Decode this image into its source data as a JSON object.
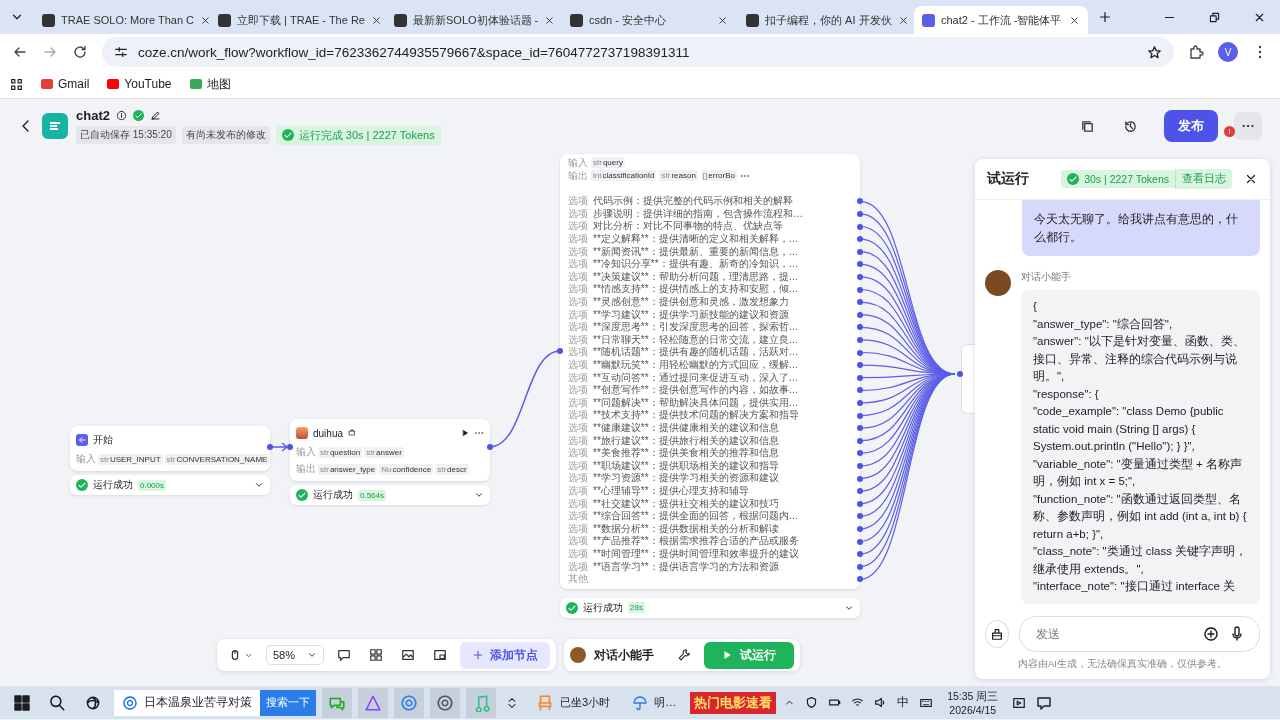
{
  "browser": {
    "tabs": [
      {
        "title": "TRAE SOLO: More Than C",
        "selected": false
      },
      {
        "title": "立即下载 | TRAE - The Re",
        "selected": false
      },
      {
        "title": "最新新SOLO初体验话题 -",
        "selected": false
      },
      {
        "title": "csdn - 安全中心",
        "selected": false
      },
      {
        "title": "扣子编程，你的 AI 开发伙",
        "selected": false
      },
      {
        "title": "chat2 - 工作流 -智能体平",
        "selected": true
      }
    ],
    "url": "coze.cn/work_flow?workflow_id=7623362744935579667&space_id=7604772737198391311",
    "bookmarks": [
      "Gmail",
      "YouTube",
      "地图"
    ],
    "profile": "V"
  },
  "header": {
    "title": "chat2",
    "autosave": "已自动保存 15:35:20",
    "unpublished": "有尚未发布的修改",
    "run_status": "运行完成 30s | 2227 Tokens",
    "publish": "发布",
    "badge": "!"
  },
  "nodes": {
    "start": {
      "title": "开始",
      "input_label": "输入",
      "inputs": [
        {
          "type": "str",
          "name": "USER_INPUT"
        },
        {
          "type": "str",
          "name": "CONVERSATION_NAME"
        }
      ],
      "status": "运行成功",
      "time": "0.000s"
    },
    "llm": {
      "title": "duihua",
      "input_label": "输入",
      "inputs": [
        {
          "type": "str",
          "name": "question"
        },
        {
          "type": "str",
          "name": "answer"
        }
      ],
      "output_label": "输出",
      "outputs": [
        {
          "type": "str",
          "name": "answer_type"
        },
        {
          "type": "Nu",
          "name": "confidence"
        },
        {
          "type": "str",
          "name": "descr"
        }
      ],
      "status": "运行成功",
      "time": "0.564s"
    },
    "classifier": {
      "input_label": "输入",
      "inputs": [
        {
          "type": "str",
          "name": "query"
        }
      ],
      "output_label": "输出",
      "outputs": [
        {
          "type": "int",
          "name": "classificationId"
        },
        {
          "type": "str",
          "name": "reason"
        },
        {
          "type": "[]",
          "name": "errorBo"
        }
      ],
      "options": [
        {
          "label": "选项",
          "text": "代码示例：提供完整的代码示例和相关的解释"
        },
        {
          "label": "选项",
          "text": "步骤说明：提供详细的指南，包含操作流程和…"
        },
        {
          "label": "选项",
          "text": "对比分析：对比不同事物的特点、优缺点等"
        },
        {
          "label": "选项",
          "text": "**定义解释**：提供清晰的定义和相关解释，…"
        },
        {
          "label": "选项",
          "text": "**新闻资讯**：提供最新、重要的新闻信息，…"
        },
        {
          "label": "选项",
          "text": "**冷知识分享**：提供有趣、新奇的冷知识，…"
        },
        {
          "label": "选项",
          "text": "**决策建议**：帮助分析问题，理清思路，提…"
        },
        {
          "label": "选项",
          "text": "**情感支持**：提供情感上的支持和安慰，倾…"
        },
        {
          "label": "选项",
          "text": "**灵感创意**：提供创意和灵感，激发想象力"
        },
        {
          "label": "选项",
          "text": "**学习建议**：提供学习新技能的建议和资源"
        },
        {
          "label": "选项",
          "text": "**深度思考**：引发深度思考的回答，探索哲…"
        },
        {
          "label": "选项",
          "text": "**日常聊天**：轻松随意的日常交流，建立良…"
        },
        {
          "label": "选项",
          "text": "**随机话题**：提供有趣的随机话题，活跃对…"
        },
        {
          "label": "选项",
          "text": "**幽默玩笑**：用轻松幽默的方式回应，缓解…"
        },
        {
          "label": "选项",
          "text": "**互动问答**：通过提问来促进互动，深入了…"
        },
        {
          "label": "选项",
          "text": "**创意写作**：提供创意写作的内容，如故事…"
        },
        {
          "label": "选项",
          "text": "**问题解决**：帮助解决具体问题，提供实用…"
        },
        {
          "label": "选项",
          "text": "**技术支持**：提供技术问题的解决方案和指导"
        },
        {
          "label": "选项",
          "text": "**健康建议**：提供健康相关的建议和信息"
        },
        {
          "label": "选项",
          "text": "**旅行建议**：提供旅行相关的建议和信息"
        },
        {
          "label": "选项",
          "text": "**美食推荐**：提供美食相关的推荐和信息"
        },
        {
          "label": "选项",
          "text": "**职场建议**：提供职场相关的建议和指导"
        },
        {
          "label": "选项",
          "text": "**学习资源**：提供学习相关的资源和建议"
        },
        {
          "label": "选项",
          "text": "**心理辅导**：提供心理支持和辅导"
        },
        {
          "label": "选项",
          "text": "**社交建议**：提供社交相关的建议和技巧"
        },
        {
          "label": "选项",
          "text": "**综合回答**：提供全面的回答，根据问题内…"
        },
        {
          "label": "选项",
          "text": "**数据分析**：提供数据相关的分析和解读"
        },
        {
          "label": "选项",
          "text": "**产品推荐**：根据需求推荐合适的产品或服务"
        },
        {
          "label": "选项",
          "text": "**时间管理**：提供时间管理和效率提升的建议"
        },
        {
          "label": "选项",
          "text": "**语言学习**：提供语言学习的方法和资源"
        }
      ],
      "other": "其他",
      "status": "运行成功",
      "time": "28s"
    }
  },
  "toolbar": {
    "zoom": "58%",
    "add_node": "添加节点",
    "bot": "对话小能手",
    "run": "试运行"
  },
  "panel": {
    "title": "试运行",
    "status": "30s | 2227 Tokens",
    "log_link": "查看日志",
    "user_message": "今天太无聊了。给我讲点有意思的，什么都行。",
    "bot_name": "对话小能手",
    "bot_reply": "{\n\"answer_type\": \"综合回答\",\n\"answer\": \"以下是针对变量、函数、类、接口、异常、注释的综合代码示例与说明。\",\n\"response\": {\n\"code_example\": \"class Demo {public static void main (String [] args) { System.out.println (\"Hello\"); } }\",\n\"variable_note\": \"变量通过类型 + 名称声明，例如 int x = 5;\",\n\"function_note\": \"函数通过返回类型、名称、参数声明，例如 int add (int a, int b) { return a+b; }\",\n\"class_note\": \"类通过 class 关键字声明，继承使用 extends。\",\n\"interface_note\": \"接口通过 interface 关",
    "placeholder": "发送",
    "disclaimer": "内容由AI生成，无法确保真实准确，仅供参考。"
  },
  "taskbar": {
    "search_value": "日本温泉业苦寻对策",
    "search_button": "搜索一下",
    "sitting": "已坐3小时",
    "weather": "明…",
    "ad": "热门电影速看",
    "ime": "中",
    "time": "15:35 周三",
    "date": "2026/4/15"
  }
}
